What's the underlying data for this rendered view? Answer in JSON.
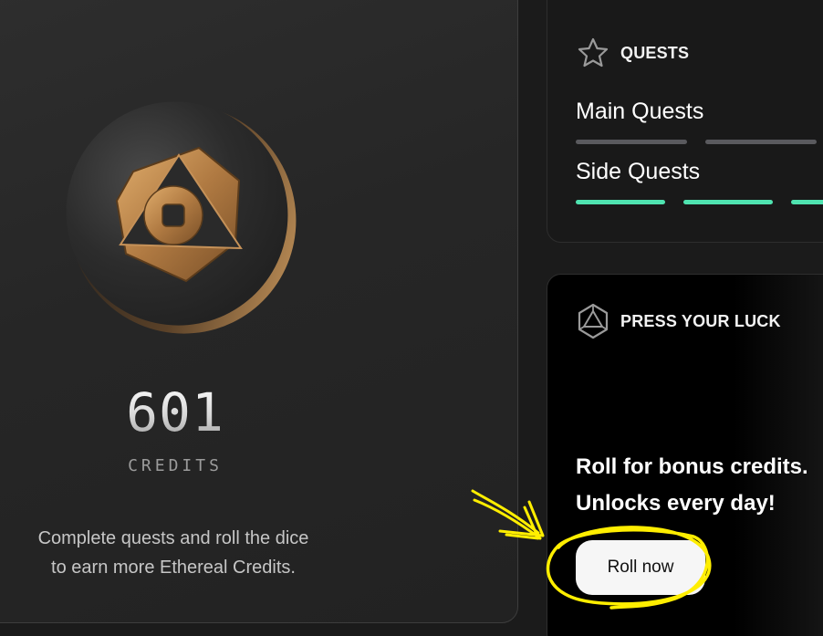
{
  "credits": {
    "amount": "601",
    "label": "CREDITS",
    "description_line1": "Complete quests and roll the dice",
    "description_line2": "to earn more Ethereal Credits.",
    "coin_icon": "ethereal-coin-icon"
  },
  "quests": {
    "title": "QUESTS",
    "icon": "star-icon",
    "main": {
      "label": "Main Quests",
      "bars_filled": 0,
      "bars_total": 3
    },
    "side": {
      "label": "Side Quests",
      "bars_filled": 3,
      "bars_total": 3
    }
  },
  "luck": {
    "title": "PRESS YOUR LUCK",
    "icon": "d20-dice-icon",
    "line1": "Roll for bonus credits.",
    "line2": "Unlocks every day!",
    "button_label": "Roll now"
  },
  "colors": {
    "accent_green": "#4fe3b0",
    "bar_gray": "#5a5a5e",
    "coin_gold": "#b8844a",
    "annotation_yellow": "#ffee00"
  }
}
